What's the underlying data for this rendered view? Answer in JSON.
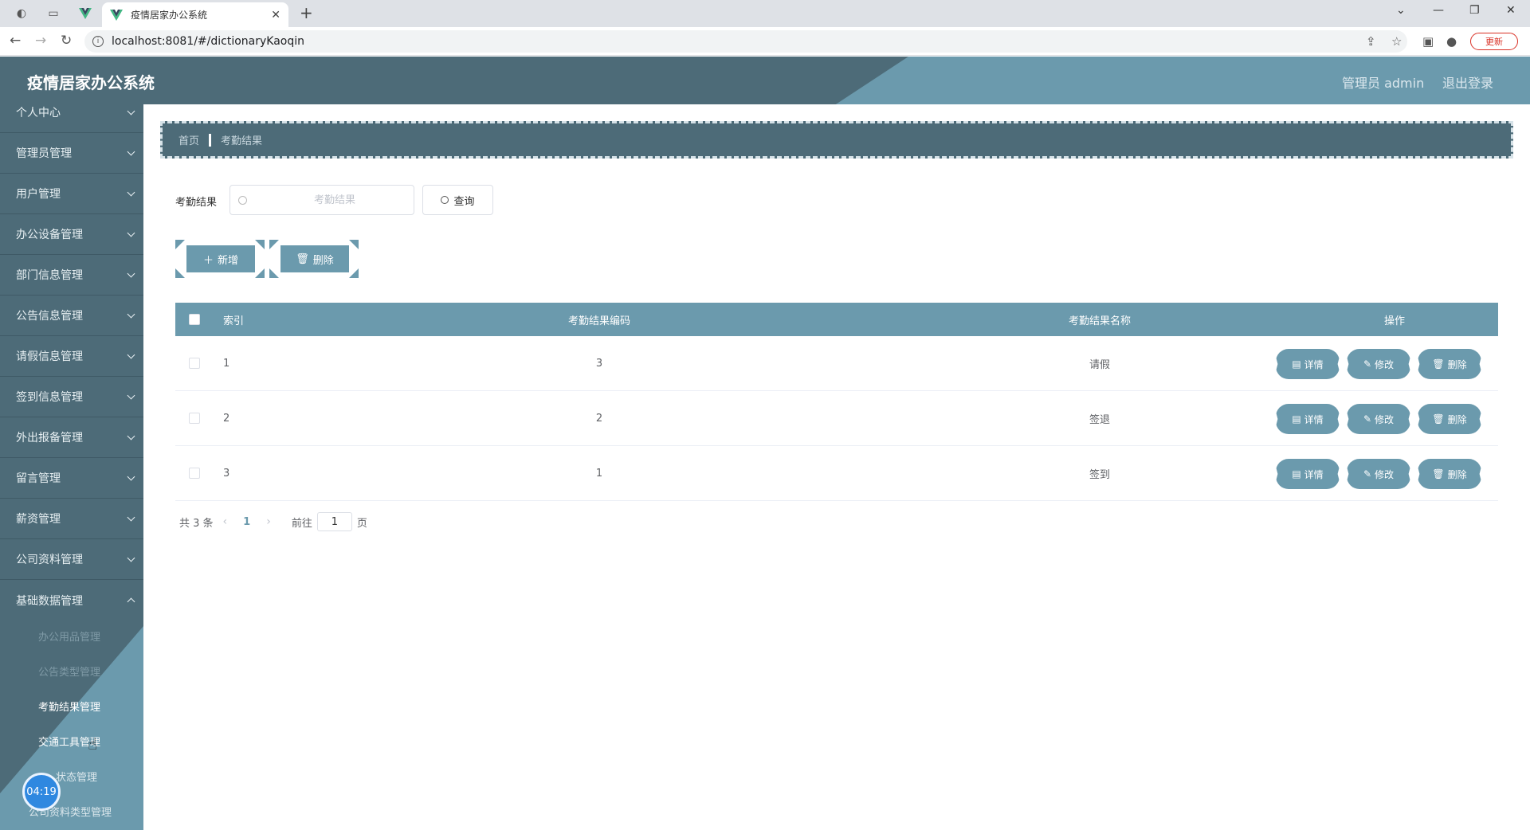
{
  "browser": {
    "tab_title": "疫情居家办公系统",
    "url": "localhost:8081/#/dictionaryKaoqin",
    "update_label": "更新"
  },
  "header": {
    "app_title": "疫情居家办公系统",
    "user_label": "管理员 admin",
    "logout_label": "退出登录"
  },
  "sidebar": {
    "menus": [
      {
        "label": "个人中心"
      },
      {
        "label": "管理员管理"
      },
      {
        "label": "用户管理"
      },
      {
        "label": "办公设备管理"
      },
      {
        "label": "部门信息管理"
      },
      {
        "label": "公告信息管理"
      },
      {
        "label": "请假信息管理"
      },
      {
        "label": "签到信息管理"
      },
      {
        "label": "外出报备管理"
      },
      {
        "label": "留言管理"
      },
      {
        "label": "薪资管理"
      },
      {
        "label": "公司资料管理"
      },
      {
        "label": "基础数据管理"
      }
    ],
    "submenus": [
      {
        "label": "办公用品管理"
      },
      {
        "label": "公告类型管理"
      },
      {
        "label": "考勤结果管理"
      },
      {
        "label": "交通工具管理"
      },
      {
        "label": "状态管理"
      },
      {
        "label": "公司资料类型管理"
      }
    ]
  },
  "timer": "04:19",
  "breadcrumb": {
    "home": "首页",
    "current": "考勤结果"
  },
  "search": {
    "label": "考勤结果",
    "placeholder": "考勤结果",
    "button": "查询"
  },
  "actions": {
    "add": "新增",
    "delete": "删除"
  },
  "table": {
    "headers": {
      "index": "索引",
      "code": "考勤结果编码",
      "name": "考勤结果名称",
      "ops": "操作"
    },
    "rows": [
      {
        "index": "1",
        "code": "3",
        "name": "请假"
      },
      {
        "index": "2",
        "code": "2",
        "name": "签退"
      },
      {
        "index": "3",
        "code": "1",
        "name": "签到"
      }
    ],
    "row_actions": {
      "detail": "详情",
      "edit": "修改",
      "delete": "删除"
    }
  },
  "pagination": {
    "total_text": "共 3 条",
    "current_page": "1",
    "goto_label": "前往",
    "goto_value": "1",
    "page_suffix": "页"
  },
  "colors": {
    "primary": "#6b9aad",
    "dark": "#4d6b78"
  }
}
